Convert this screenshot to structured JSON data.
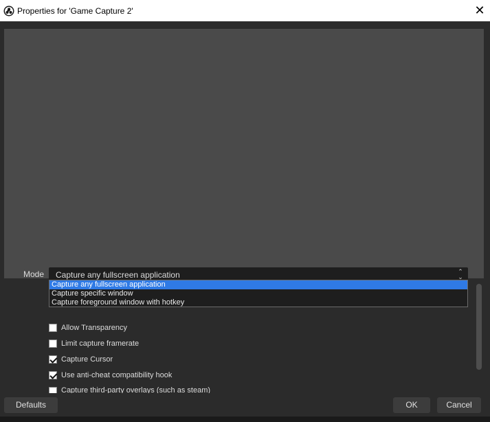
{
  "window": {
    "title": "Properties for 'Game Capture 2'",
    "close_glyph": "✕"
  },
  "mode": {
    "label": "Mode",
    "value": "Capture any fullscreen application",
    "arrow_glyph": "⌃⌄",
    "options": [
      "Capture any fullscreen application",
      "Capture specific window",
      "Capture foreground window with hotkey"
    ],
    "selected_index": 0
  },
  "checkboxes": [
    {
      "label": "Allow Transparency",
      "checked": false
    },
    {
      "label": "Limit capture framerate",
      "checked": false
    },
    {
      "label": "Capture Cursor",
      "checked": true
    },
    {
      "label": "Use anti-cheat compatibility hook",
      "checked": true
    },
    {
      "label": "Capture third-party overlays (such as steam)",
      "checked": false
    }
  ],
  "buttons": {
    "defaults": "Defaults",
    "ok": "OK",
    "cancel": "Cancel"
  },
  "colors": {
    "background": "#2b2b2b",
    "preview": "#4a4a4a",
    "selection": "#2f7ae5"
  }
}
